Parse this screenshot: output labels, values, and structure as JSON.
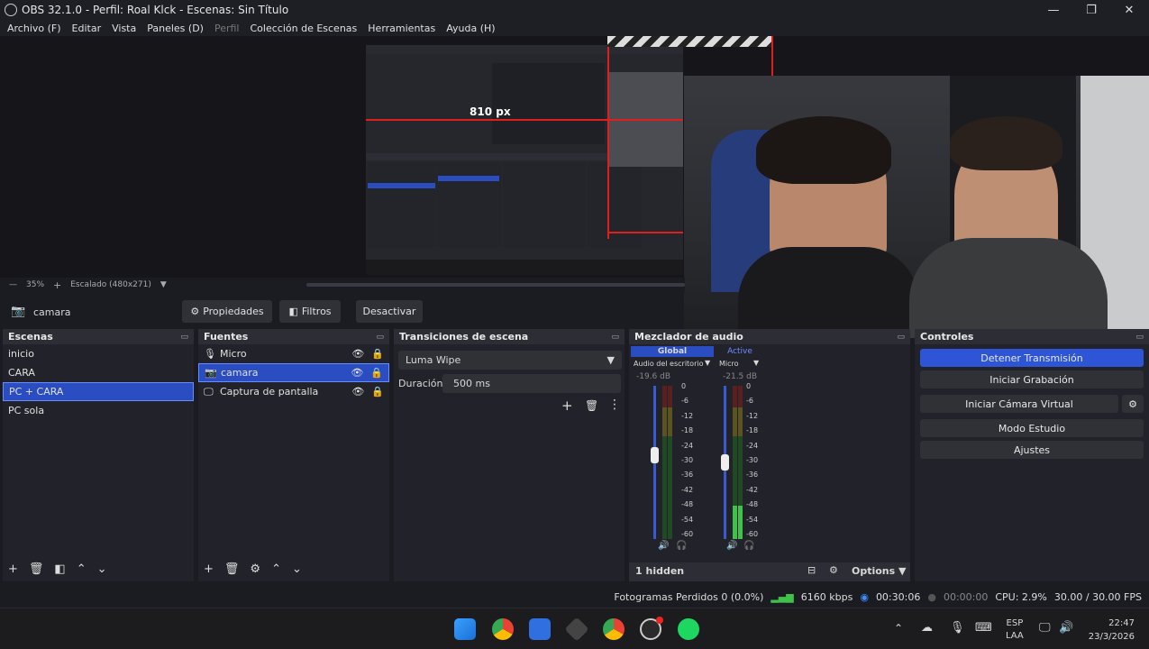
{
  "window": {
    "title": "OBS 32.1.0 - Perfil: Roal Klck - Escenas: Sin Título",
    "minimize": "—",
    "maximize": "❐",
    "close": "✕"
  },
  "menu": [
    "Archivo (F)",
    "Editar",
    "Vista",
    "Paneles (D)",
    "Perfil",
    "Colección de Escenas",
    "Herramientas",
    "Ayuda (H)"
  ],
  "preview": {
    "measure_label": "810 px",
    "zoom": "35%",
    "scaled": "Escalado (480x271)"
  },
  "source_toolbar": {
    "source_name": "camara",
    "properties": "Propiedades",
    "filters": "Filtros",
    "deactivate": "Desactivar"
  },
  "scenes": {
    "title": "Escenas",
    "items": [
      "inicio",
      "CARA",
      "PC + CARA",
      "PC sola"
    ],
    "selected": 2
  },
  "sources": {
    "title": "Fuentes",
    "items": [
      {
        "name": "Micro",
        "icon": "microphone-icon"
      },
      {
        "name": "camara",
        "icon": "camera-icon"
      },
      {
        "name": "Captura de pantalla",
        "icon": "monitor-icon"
      }
    ],
    "selected": 1
  },
  "transitions": {
    "title": "Transiciones de escena",
    "type": "Luma Wipe",
    "duration_label": "Duración",
    "duration_value": "500 ms"
  },
  "mixer": {
    "title": "Mezclador de audio",
    "tab_global": "Global",
    "tab_active": "Active",
    "channels": [
      {
        "name": "Audio del escritorio",
        "db": "-19.6 dB",
        "fader": 0.55,
        "level": 0.0
      },
      {
        "name": "Micro",
        "db": "-21.5 dB",
        "fader": 0.5,
        "level": 0.22
      }
    ],
    "ticks": [
      "0",
      "-6",
      "-12",
      "-18",
      "-24",
      "-30",
      "-36",
      "-42",
      "-48",
      "-54",
      "-60"
    ],
    "hidden": "1 hidden",
    "options": "Options"
  },
  "controls": {
    "title": "Controles",
    "buttons": [
      "Detener Transmisión",
      "Iniciar Grabación",
      "Iniciar Cámara Virtual",
      "Modo Estudio",
      "Ajustes"
    ]
  },
  "status": {
    "dropped": "Fotogramas Perdidos 0 (0.0%)",
    "bitrate": "6160 kbps",
    "stream_time": "00:30:06",
    "rec_time": "00:00:00",
    "cpu": "CPU: 2.9%",
    "fps": "30.00 / 30.00 FPS"
  },
  "taskbar": {
    "lang": "ESP",
    "lang2": "LAA",
    "time": "22:47",
    "date": "23/3/2026"
  },
  "colors": {
    "accent": "#2a4dc2",
    "stream_active": "#2e55d6",
    "meter_green": "#3ec24a",
    "meter_yellow": "#c9b23a",
    "meter_red": "#c23a3a"
  }
}
